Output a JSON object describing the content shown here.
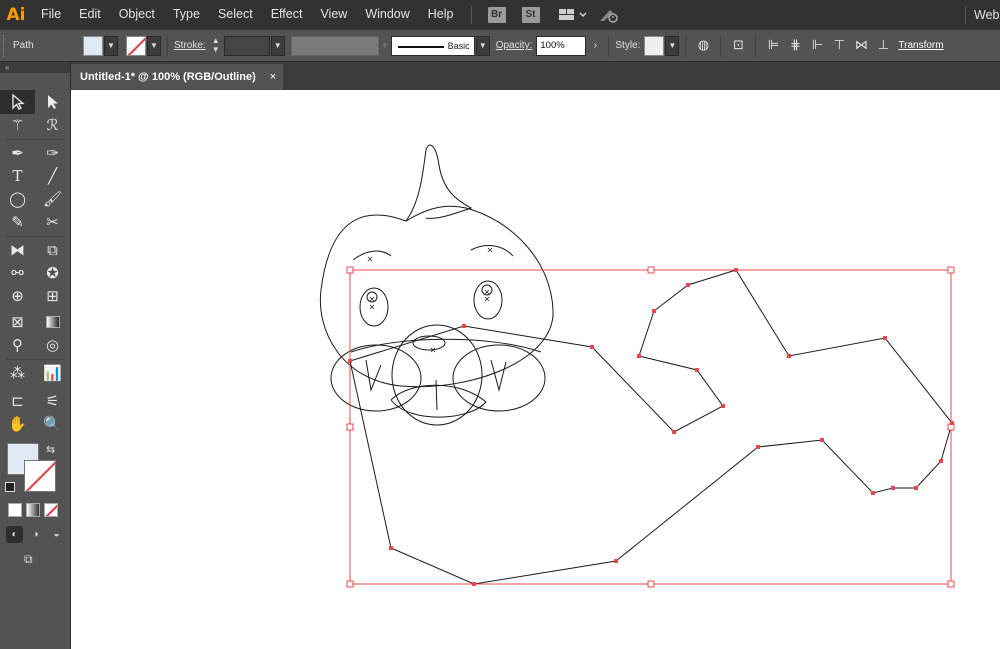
{
  "app": {
    "logo": "Ai"
  },
  "menu": [
    "File",
    "Edit",
    "Object",
    "Type",
    "Select",
    "Effect",
    "View",
    "Window",
    "Help"
  ],
  "app_buttons": {
    "bridge": "Br",
    "stock": "St"
  },
  "workspace_label": "Web",
  "control_bar": {
    "selection_type": "Path",
    "stroke_label": "Stroke:",
    "stroke_weight": "",
    "brush_label": "Basic",
    "opacity_label": "Opacity:",
    "opacity_value": "100%",
    "style_label": "Style:",
    "transform_label": "Transform",
    "fill_color": "#e1e9f5",
    "stroke_color": "none"
  },
  "document_tab": {
    "title": "Untitled-1* @ 100% (RGB/Outline)",
    "close": "×"
  },
  "tools_panel": {
    "collapse": "«"
  },
  "colors": {
    "selection": "#e8474c",
    "ui_dark": "#323232",
    "ui_mid": "#535353",
    "canvas": "#ffffff",
    "accent": "#ff9a00"
  }
}
